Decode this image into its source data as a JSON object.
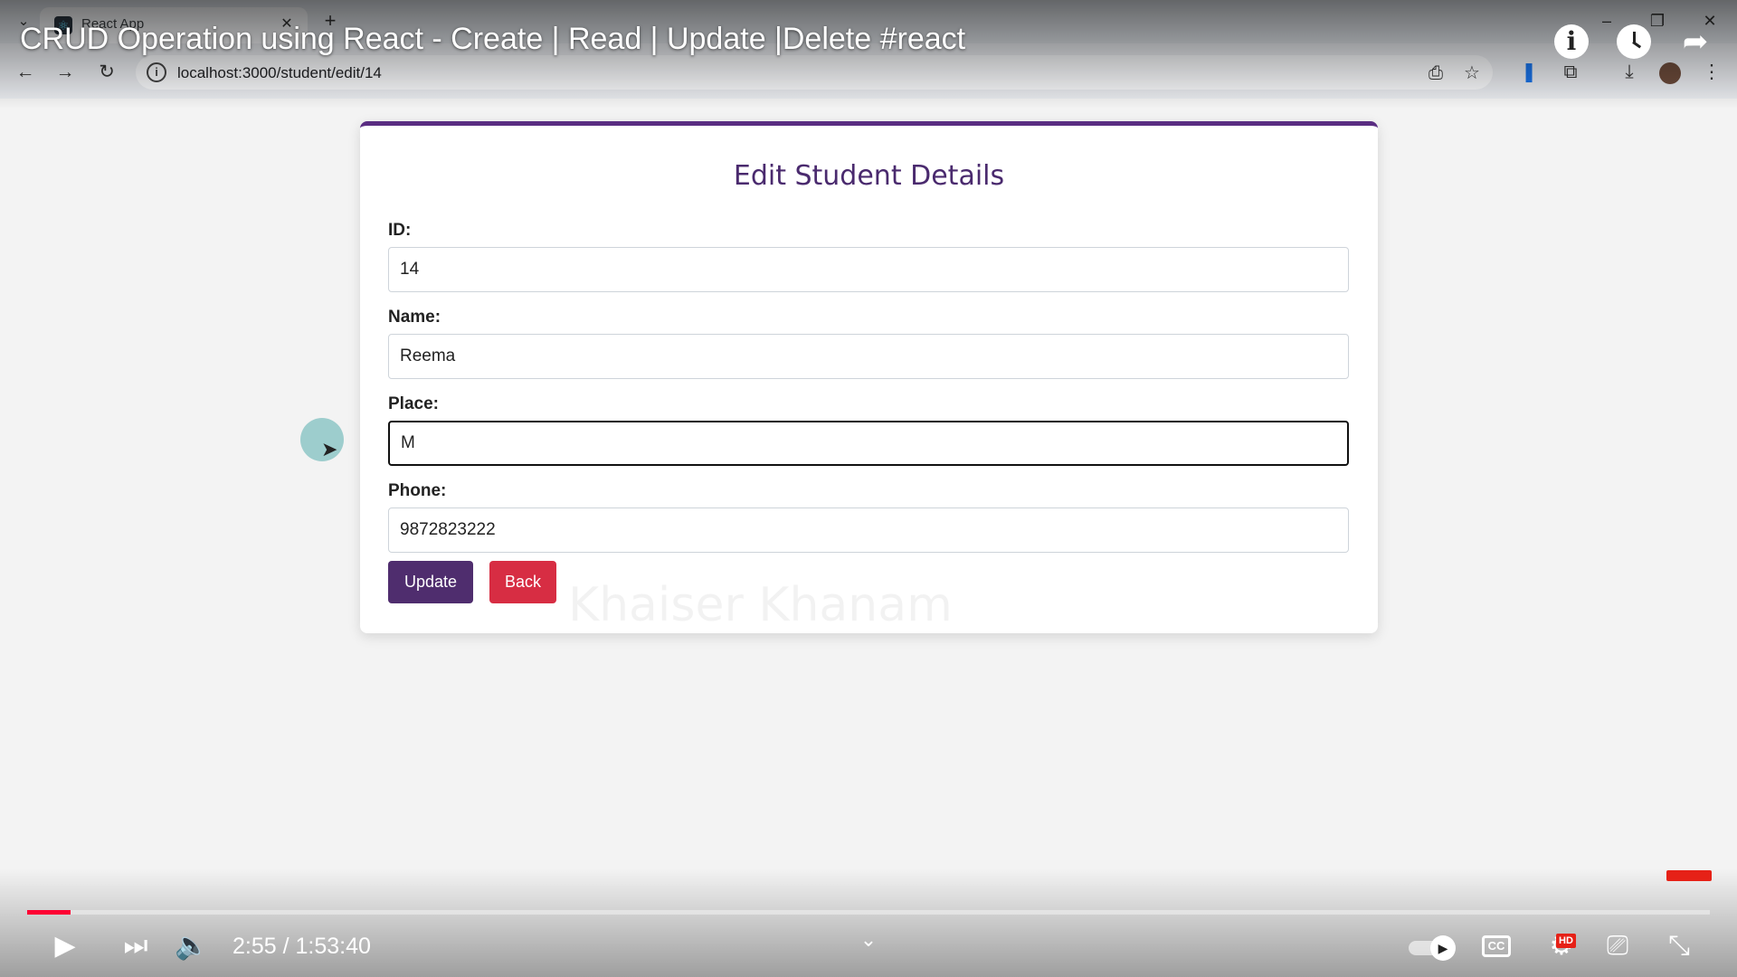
{
  "browser": {
    "tab_title": "React App",
    "url": "localhost:3000/student/edit/14"
  },
  "video": {
    "title": "CRUD Operation using React - Create | Read | Update |Delete #react",
    "time": "2:55 / 1:53:40",
    "progress_fraction": 0.026,
    "quality_badge": "HD",
    "cc_label": "CC"
  },
  "form": {
    "title": "Edit Student Details",
    "fields": [
      {
        "label": "ID:",
        "value": "14"
      },
      {
        "label": "Name:",
        "value": "Reema"
      },
      {
        "label": "Place:",
        "value": "M"
      },
      {
        "label": "Phone:",
        "value": "9872823222"
      }
    ],
    "update_label": "Update",
    "back_label": "Back",
    "watermark": "Khaiser Khanam"
  },
  "colors": {
    "accent": "#5a2d82",
    "update_button": "#4f2d6e",
    "back_button": "#d72d43",
    "progress": "#ff0033"
  },
  "icons": {
    "tab_menu": "chevron-down-icon",
    "favicon": "react-icon",
    "tab_close": "close-icon",
    "new_tab": "plus-icon",
    "back": "arrow-left-icon",
    "forward": "arrow-right-icon",
    "reload": "reload-icon",
    "site_info": "info-icon",
    "install": "install-icon",
    "bookmark": "star-icon",
    "extensions": "puzzle-icon",
    "downloads": "download-icon",
    "menu": "kebab-icon",
    "play": "play-icon",
    "next": "skip-next-icon",
    "volume": "volume-icon",
    "settings": "gear-icon",
    "cast": "cast-icon",
    "exit_fullscreen": "exit-fullscreen-icon",
    "share": "share-icon",
    "watch_later": "clock-icon"
  }
}
